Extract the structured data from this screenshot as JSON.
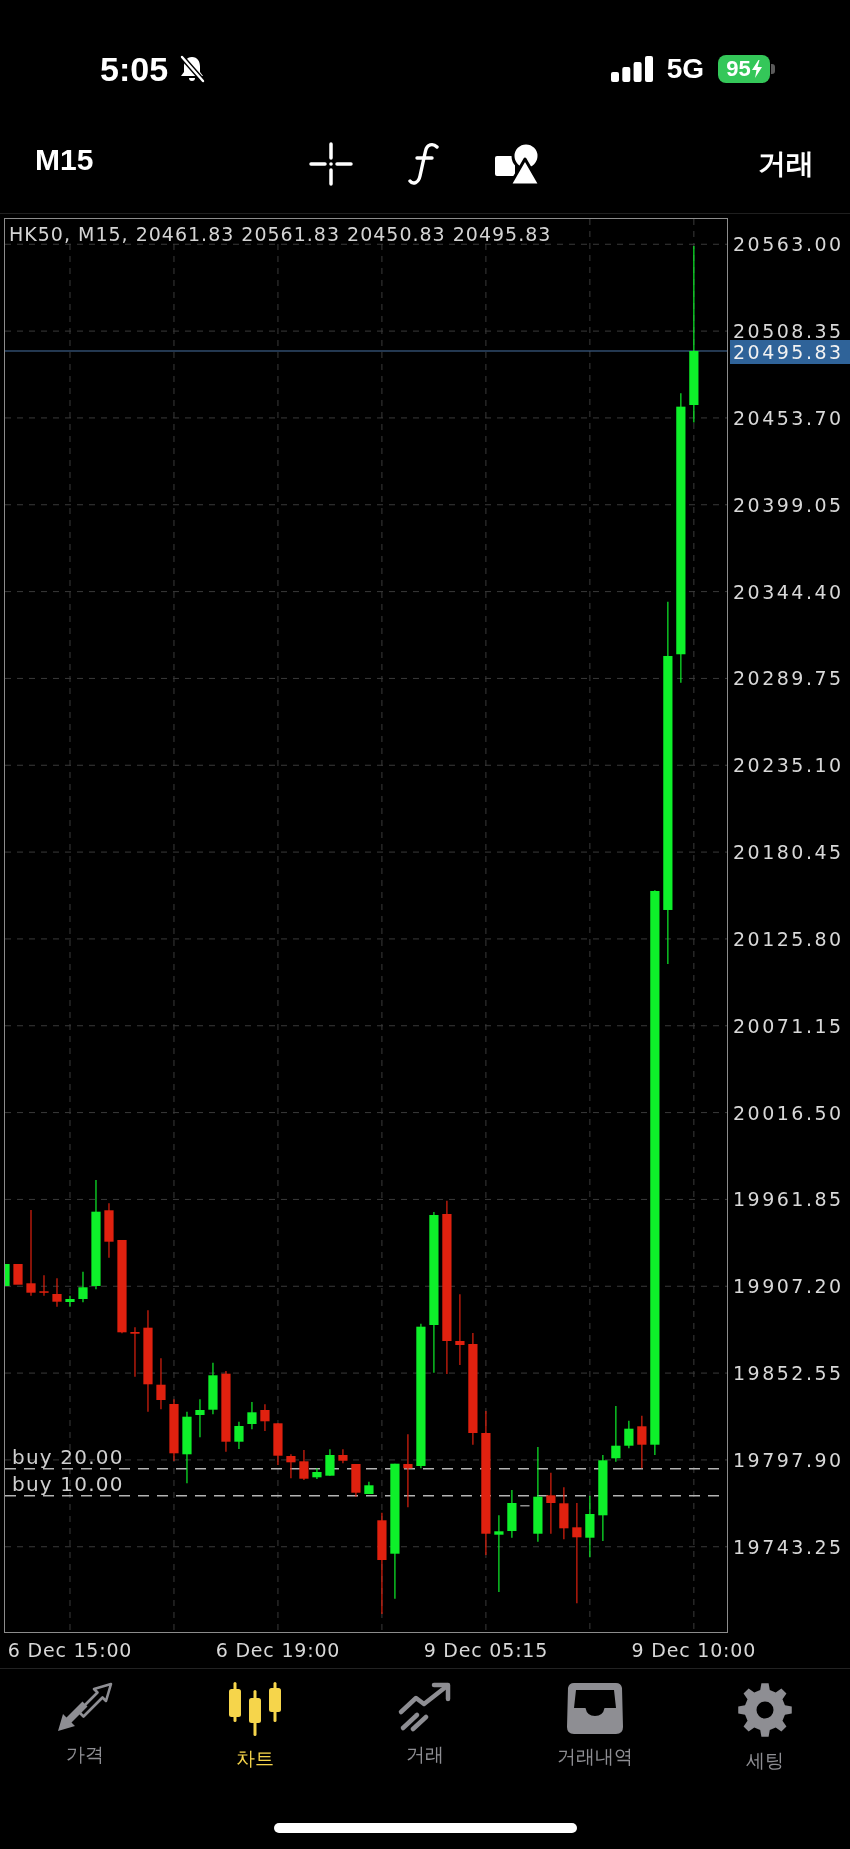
{
  "status_bar": {
    "time": "5:05",
    "silent": true,
    "network": "5G",
    "battery": "95",
    "charging": true
  },
  "toolbar": {
    "timeframe": "M15",
    "trade": "거래"
  },
  "chart": {
    "chart_data": {
      "type": "candlestick",
      "title": "HK50, M15, 20461.83 20561.83 20450.83 20495.83",
      "grid": true,
      "categories": [
        null,
        null,
        null,
        null,
        null,
        "6 Dec 15:00",
        null,
        null,
        null,
        null,
        null,
        null,
        null,
        null,
        null,
        null,
        null,
        null,
        null,
        null,
        null,
        "6 Dec 19:00",
        null,
        null,
        null,
        null,
        null,
        null,
        null,
        null,
        null,
        null,
        null,
        null,
        null,
        null,
        null,
        "9 Dec 05:15",
        null,
        null,
        null,
        null,
        null,
        null,
        null,
        null,
        null,
        null,
        null,
        null,
        null,
        null,
        null,
        "9 Dec 10:00"
      ],
      "ohlc": [
        [
          19907.37,
          19921.21,
          19907.37,
          19921.21
        ],
        [
          19921.21,
          19921.21,
          19908.18,
          19908.18
        ],
        [
          19909.06,
          19955.2,
          19901.26,
          19903.15
        ],
        [
          19904.03,
          19914.1,
          19901.26,
          19903.15
        ],
        [
          19902.33,
          19912.21,
          19894.34,
          19897.48
        ],
        [
          19897.29,
          19901.26,
          19894.34,
          19899.18
        ],
        [
          19899.18,
          19916.36,
          19897.11,
          19906.55
        ],
        [
          19907.37,
          19974.08,
          19905.29,
          19954.13
        ],
        [
          19955.01,
          19959.42,
          19925.18,
          19935.25
        ],
        [
          19936.32,
          19936.32,
          19877.59,
          19878.22
        ],
        [
          19878.41,
          19881.37,
          19850.28,
          19877.34
        ],
        [
          19881.12,
          19892.07,
          19828.25,
          19845.5
        ],
        [
          19845.24,
          19861.86,
          19829.76,
          19835.61
        ],
        [
          19833.1,
          19836.05,
          19797.22,
          19802.07
        ],
        [
          19801.44,
          19828.25,
          19783.19,
          19825.1
        ],
        [
          19826.17,
          19836.05,
          19812.14,
          19829.32
        ],
        [
          19829.51,
          19859.09,
          19826.61,
          19851.16
        ],
        [
          19852.17,
          19853.87,
          19803.07,
          19809.37
        ],
        [
          19809.37,
          19821.96,
          19804.77,
          19819.25
        ],
        [
          19820.51,
          19834.36,
          19817.17,
          19827.87
        ],
        [
          19829.32,
          19832.91,
          19816.1,
          19822.21
        ],
        [
          19820.95,
          19820.95,
          19794.7,
          19800.56
        ],
        [
          19800.37,
          19801.44,
          19786.33,
          19796.4
        ],
        [
          19797.03,
          19804.14,
          19785.26,
          19786.08
        ],
        [
          19786.96,
          19792.63,
          19785.89,
          19790.3
        ],
        [
          19787.97,
          19804.59,
          19787.97,
          19801.0
        ],
        [
          19801.0,
          19804.59,
          19795.77,
          19797.41
        ],
        [
          19795.33,
          19795.33,
          19774.75,
          19777.27
        ],
        [
          19776.45,
          19784.19,
          19776.45,
          19781.93
        ],
        [
          19759.9,
          19764.68,
          19700.92,
          19734.91
        ],
        [
          19738.88,
          19795.52,
          19710.55,
          19795.52
        ],
        [
          19795.33,
          19814.03,
          19768.08,
          19792.63
        ],
        [
          19794.07,
          19883.64,
          19792.63,
          19881.75
        ],
        [
          19882.82,
          19953.93,
          19852.8,
          19952.05
        ],
        [
          19952.68,
          19961.05,
          19851.98,
          19872.75
        ],
        [
          19872.75,
          19902.14,
          19857.64,
          19870.23
        ],
        [
          19870.86,
          19877.78,
          19807.48,
          19814.84
        ],
        [
          19814.84,
          19828.69,
          19738.06,
          19751.46
        ],
        [
          19750.84,
          19763.05,
          19714.77,
          19752.98
        ],
        [
          19753.16,
          19778.97,
          19748.95,
          19770.79
        ],
        [
          19769.53,
          19769.53,
          19769.53,
          19769.53
        ],
        [
          19751.46,
          19806.03,
          19746.43,
          19774.75
        ],
        [
          19775.63,
          19789.86,
          19751.46,
          19770.79
        ],
        [
          19770.6,
          19780.67,
          19747.94,
          19754.86
        ],
        [
          19755.49,
          19770.79,
          19707.66,
          19749.2
        ],
        [
          19748.95,
          19775.38,
          19736.61,
          19763.86
        ],
        [
          19763.05,
          19801.0,
          19746.87,
          19797.66
        ],
        [
          19798.92,
          19831.84,
          19796.78,
          19806.85
        ],
        [
          19806.85,
          19822.59,
          19805.21,
          19817.55
        ],
        [
          19819.06,
          19825.73,
          19792.63,
          19807.48
        ],
        [
          19807.48,
          20156.41,
          19801.0,
          20155.97
        ],
        [
          20144.02,
          20338.06,
          20110.03,
          20303.88
        ],
        [
          20304.95,
          20469.22,
          20287.08,
          20460.79
        ],
        [
          20461.83,
          20561.83,
          20450.83,
          20495.83
        ]
      ],
      "ylim": [
        19689.6,
        20578.9
      ],
      "yticks": [
        {
          "value": 20563,
          "label": "20563.00"
        },
        {
          "value": 20508.35,
          "label": "20508.35"
        },
        {
          "value": 20453.7,
          "label": "20453.70"
        },
        {
          "value": 20399.05,
          "label": "20399.05"
        },
        {
          "value": 20344.4,
          "label": "20344.40"
        },
        {
          "value": 20289.75,
          "label": "20289.75"
        },
        {
          "value": 20235.1,
          "label": "20235.10"
        },
        {
          "value": 20180.45,
          "label": "20180.45"
        },
        {
          "value": 20125.8,
          "label": "20125.80"
        },
        {
          "value": 20071.15,
          "label": "20071.15"
        },
        {
          "value": 20016.5,
          "label": "20016.50"
        },
        {
          "value": 19961.85,
          "label": "19961.85"
        },
        {
          "value": 19907.2,
          "label": "19907.20"
        },
        {
          "value": 19852.55,
          "label": "19852.55"
        },
        {
          "value": 19797.9,
          "label": "19797.90"
        },
        {
          "value": 19743.25,
          "label": "19743.25"
        }
      ],
      "ref_lines": [
        {
          "axis": "y",
          "value": 20495.83,
          "label": "20495.83",
          "color": "#3b5d86"
        },
        {
          "axis": "y",
          "value": 19792.38,
          "label": "buy 20.00",
          "color": "#b4b4b4"
        },
        {
          "axis": "y",
          "value": 19775.39,
          "label": "buy 10.00",
          "color": "#b4b4b4"
        }
      ]
    }
  },
  "tabs": [
    {
      "label": "가격",
      "selected": false
    },
    {
      "label": "차트",
      "selected": true
    },
    {
      "label": "거래",
      "selected": false
    },
    {
      "label": "거래내역",
      "selected": false
    },
    {
      "label": "세팅",
      "selected": false
    }
  ]
}
